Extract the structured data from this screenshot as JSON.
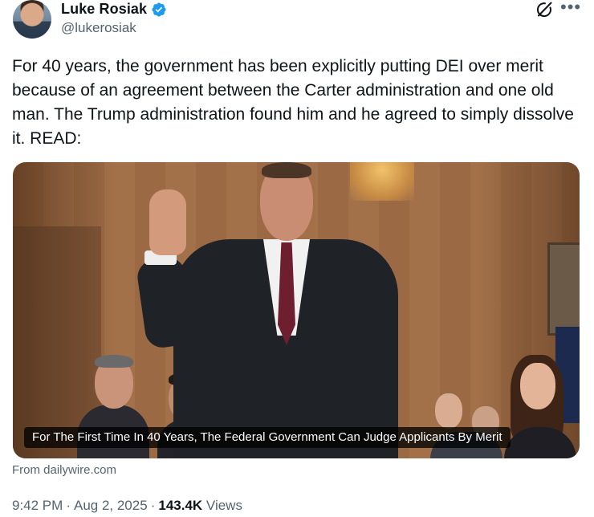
{
  "author": {
    "name": "Luke Rosiak",
    "handle": "@lukerosiak",
    "verified": true,
    "verified_color": "#1d9bf0"
  },
  "header_icons": [
    "grok-icon",
    "more-icon"
  ],
  "tweet": {
    "text": "For 40 years, the government has been explicitly putting DEI over merit because of an agreement between the Carter administration and one old man. The Trump administration found him and he agreed to simply dissolve it. READ:"
  },
  "card": {
    "caption": "For The First Time In 40 Years, The Federal Government Can Judge Applicants By Merit",
    "source": "From dailywire.com"
  },
  "meta": {
    "time": "9:42 PM",
    "date": "Aug 2, 2025",
    "views_count": "143.4K",
    "views_label": "Views"
  },
  "colors": {
    "text": "#0f1419",
    "secondary": "#536471"
  }
}
